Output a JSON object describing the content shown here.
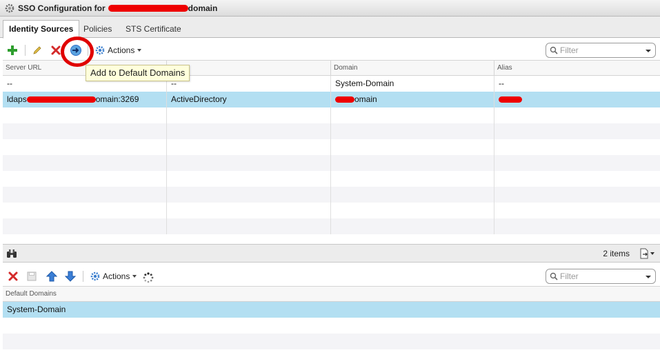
{
  "window": {
    "title_prefix": "SSO Configuration for",
    "title_suffix": "domain",
    "icon": "gear-icon"
  },
  "tabs": [
    {
      "label": "Identity Sources",
      "active": true
    },
    {
      "label": "Policies",
      "active": false
    },
    {
      "label": "STS Certificate",
      "active": false
    }
  ],
  "toolbar_top": {
    "icons": [
      "add-icon",
      "edit-icon",
      "delete-icon",
      "add-to-default-domains-icon",
      "actions-gear-icon"
    ],
    "actions_label": "Actions",
    "filter_placeholder": "Filter"
  },
  "tooltip": {
    "text": "Add to Default Domains"
  },
  "identity_sources_table": {
    "columns": [
      "Server URL",
      "",
      "Domain",
      "Alias"
    ],
    "rows": [
      {
        "server_url": "--",
        "type": "--",
        "domain": "System-Domain",
        "alias": "--"
      },
      {
        "server_url_prefix": "ldaps",
        "server_url_suffix": "omain:3269",
        "type": "ActiveDirectory",
        "domain_suffix": "omain",
        "alias": ""
      }
    ],
    "selected_row": 1
  },
  "footer": {
    "items_count": "2 items"
  },
  "toolbar_bottom": {
    "icons": [
      "delete-icon",
      "save-icon",
      "move-up-icon",
      "move-down-icon",
      "actions-gear-icon",
      "loading-icon"
    ],
    "actions_label": "Actions",
    "filter_placeholder": "Filter"
  },
  "default_domains_table": {
    "columns": [
      "Default Domains"
    ],
    "rows": [
      "System-Domain"
    ],
    "selected_row": 0
  },
  "colors": {
    "selection": "#b3dff2",
    "tooltip_bg": "#ffffdc",
    "annotation_red": "#e00000",
    "add_green": "#2e9e2e",
    "delete_red": "#d42a2a",
    "arrow_blue": "#2f6fc8"
  }
}
